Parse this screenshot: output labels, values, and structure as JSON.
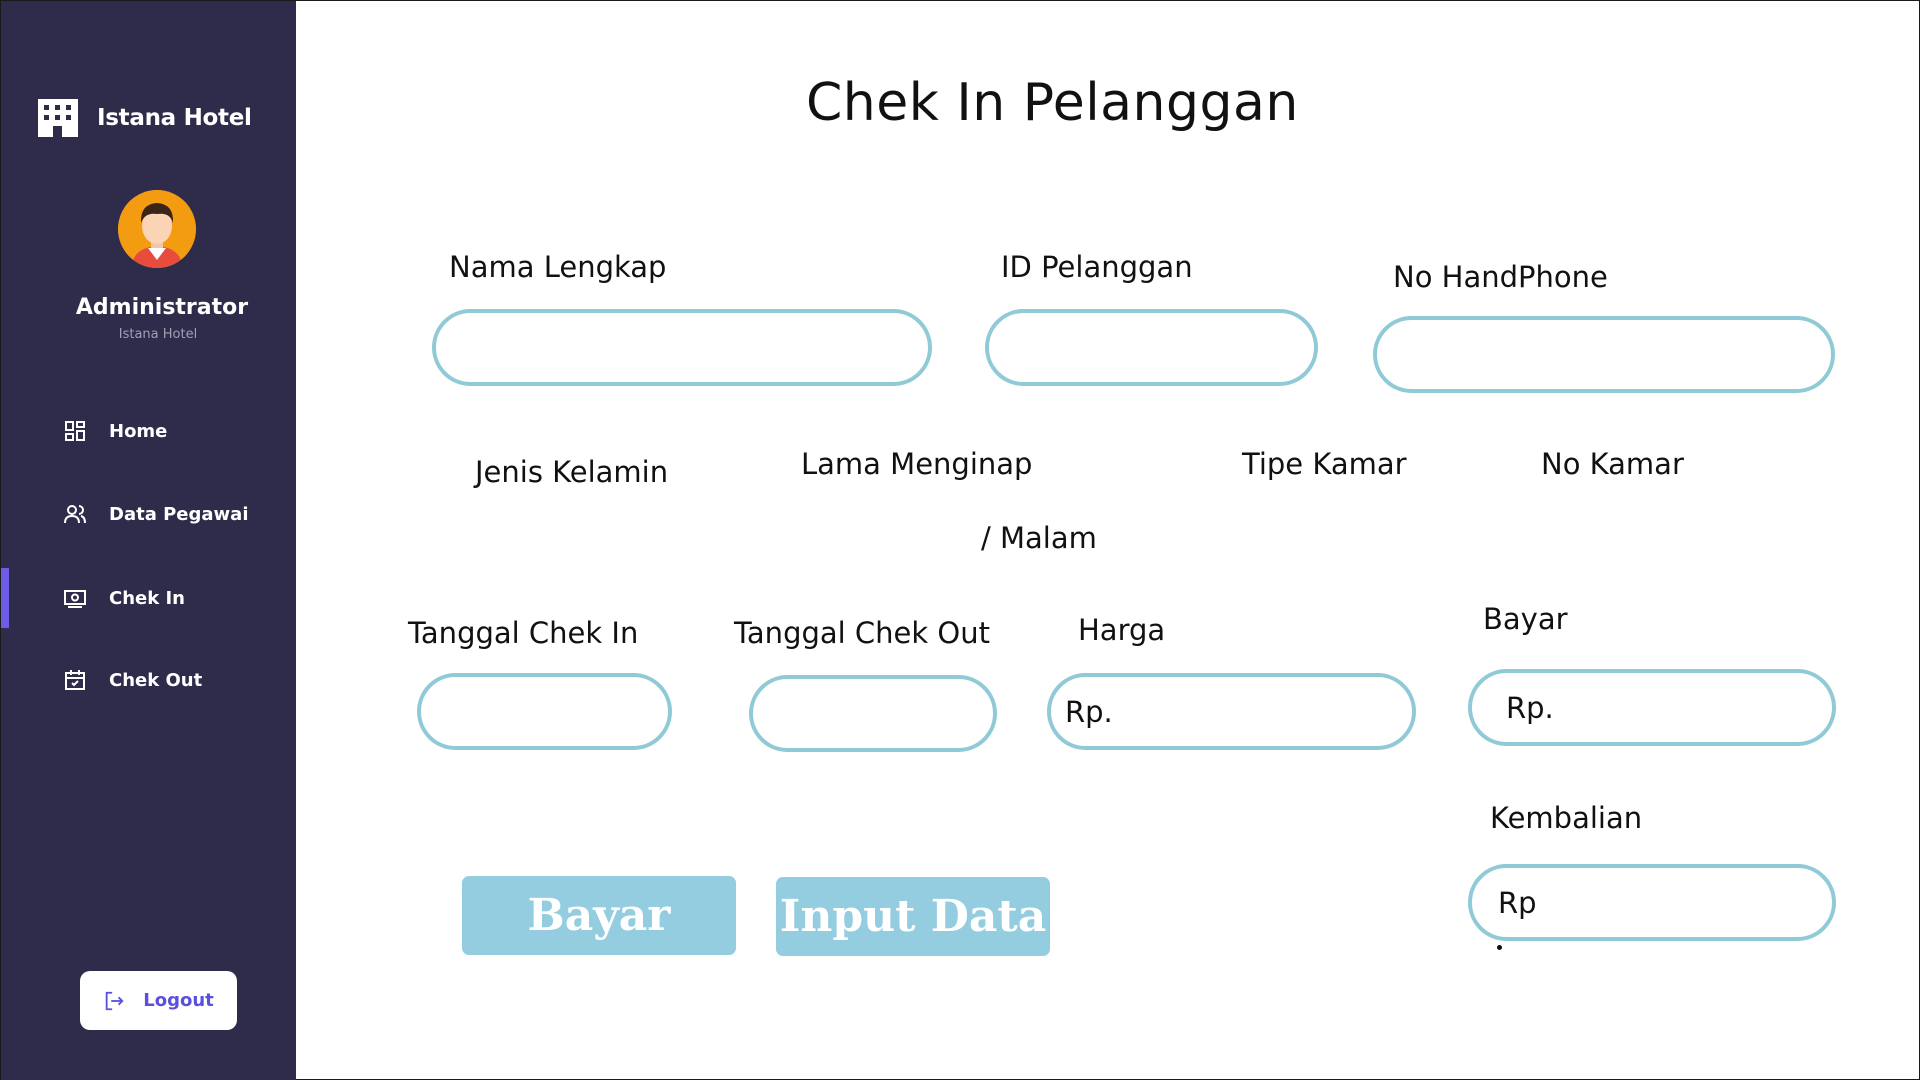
{
  "sidebar": {
    "brand": "Istana Hotel",
    "user": {
      "name": "Administrator",
      "subtitle": "Istana Hotel"
    },
    "nav": [
      {
        "label": "Home",
        "icon": "dashboard-icon",
        "active": false
      },
      {
        "label": "Data Pegawai",
        "icon": "users-icon",
        "active": false
      },
      {
        "label": "Chek In",
        "icon": "check-in-icon",
        "active": true
      },
      {
        "label": "Chek Out",
        "icon": "calendar-icon",
        "active": false
      }
    ],
    "logout": "Logout"
  },
  "main": {
    "title": "Chek In Pelanggan",
    "labels": {
      "nama": "Nama Lengkap",
      "id": "ID Pelanggan",
      "hp": "No HandPhone",
      "jenis": "Jenis Kelamin",
      "lama": "Lama Menginap",
      "lama2": "/ Malam",
      "tipe": "Tipe Kamar",
      "nokamar": "No Kamar",
      "tglin": "Tanggal Chek In",
      "tglout": "Tanggal Chek Out",
      "harga": "Harga",
      "bayar": "Bayar",
      "kembalian": "Kembalian"
    },
    "fields": {
      "nama": "",
      "id": "",
      "hp": "",
      "tglin": "",
      "tglout": "",
      "harga": "Rp.",
      "bayar": "Rp.",
      "kembalian": "Rp"
    },
    "buttons": {
      "bayar": "Bayar",
      "input": "Input Data"
    }
  },
  "colors": {
    "sidebar": "#2e2c4a",
    "accent": "#6c5ce7",
    "field_border": "#8fcad6",
    "button": "#95cde0",
    "avatar": "#f39c12"
  }
}
